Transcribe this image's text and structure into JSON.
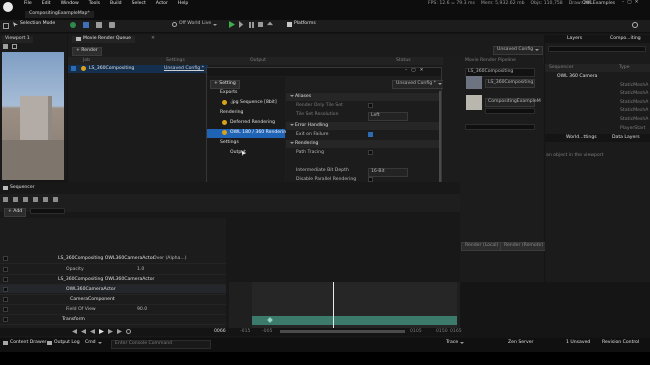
{
  "titlebar": {
    "app_title": "CompositingExampleMap*",
    "project": "OWLExamples",
    "stats": [
      "FPS: 12.6 = 79.3 ms",
      "Mem: 5,932.62 mb",
      "Objs: 110,758",
      "Draw: 291"
    ]
  },
  "menu": [
    "File",
    "Edit",
    "Window",
    "Tools",
    "Build",
    "Select",
    "Actor",
    "Help"
  ],
  "toolbar": {
    "selection_mode": "Selection Mode",
    "world": "Off World Live",
    "platforms": "Platforms"
  },
  "viewport": {
    "tab": "Viewport 1"
  },
  "mrq": {
    "tab": "Movie Render Queue",
    "render_label": "+ Render",
    "cols": [
      "Job",
      "Settings",
      "Output",
      "Status"
    ],
    "job": "LS_360Compositing",
    "job_settings": "Unsaved Config *",
    "unsaved_config": "Unsaved Config"
  },
  "settings_dialog": {
    "add_label": "+ Setting",
    "preset": "Unsaved Config *",
    "categories": [
      {
        "label": "Exports"
      },
      {
        "label": ".jpg Sequence [8bit]"
      },
      {
        "label": "Rendering"
      },
      {
        "label": "Deferred Rendering"
      },
      {
        "label": "OWL 180 / 360 Rendering"
      },
      {
        "label": "Settings"
      },
      {
        "label": "Output"
      }
    ],
    "props": [
      {
        "label": "Aliases"
      },
      {
        "label": "Render Only Tile Set"
      },
      {
        "label": "Tile Set Resolution",
        "value": "Left"
      },
      {
        "label": "Error Handling"
      },
      {
        "label": "Exit on Failure"
      },
      {
        "label": "Rendering"
      },
      {
        "label": "Path Tracing"
      },
      {
        "label": "Intermediate Bit Depth",
        "value": "16-Bit"
      },
      {
        "label": "Disable Parallel Rendering"
      },
      {
        "label": "Interpolation Type",
        "value": "Bilinear Sampling"
      },
      {
        "label": "Advanced"
      },
      {
        "label": "Rendering Nodes",
        "value": "1 Array element"
      },
      {
        "label": "Index [0]",
        "value": "OR"
      },
      {
        "label": "Maintain Frame Order"
      },
      {
        "label": "High Resolution Renders"
      },
      {
        "label": "Intermediate Output Directory",
        "value": "G:/Unreal Projects/OWLExam"
      },
      {
        "label": "Intermediate File Prefix",
        "value": "{sequence_name}_"
      },
      {
        "label": "Job Name Prefix",
        "value": "360"
      }
    ],
    "cancel": "Cancel",
    "accept": "Accept"
  },
  "pipeline": {
    "title": "Movie Render Pipeline",
    "sequence": "LS_360Compositing",
    "composite": "CompositingExampleM",
    "render_local": "Render (Local)",
    "render_remote": "Render (Remote)"
  },
  "outliner": {
    "tabs": [
      "Layers",
      "Compo...iting"
    ],
    "cols": [
      "Sequencer",
      "Type"
    ],
    "items": [
      "OWL 360 Camera",
      "StaticMeshA",
      "StaticMeshA",
      "StaticMeshA",
      "StaticMeshA",
      "StaticMeshA",
      "PlayerStart"
    ],
    "details_tabs": [
      "World...ttings",
      "Data Layers"
    ],
    "hint": "an object in the viewport"
  },
  "sequencer": {
    "tab": "Sequencer",
    "add": "+ Add",
    "search": "Search Tracks",
    "tracks": [
      {
        "label": "LS_360Compositing OWL360CameraActor",
        "value": "Over (Alpha...)"
      },
      {
        "label": "Opacity",
        "value": "1.0"
      },
      {
        "label": "LS_360Compositing OWL360CameraActor"
      },
      {
        "label": "OWL360CameraActor"
      },
      {
        "label": "CameraComponent"
      },
      {
        "label": "Field Of View",
        "value": "90.0"
      },
      {
        "label": "Transform"
      }
    ],
    "frame": "0066",
    "ticks": [
      "-015",
      "-005",
      "0105",
      "0150",
      "0165"
    ]
  },
  "statusbar": {
    "content_drawer": "Content Drawer",
    "output_log": "Output Log",
    "cmd": "Cmd",
    "console": "Enter Console Command",
    "trace": "Trace",
    "zen": "Zen Server",
    "unsaved": "1 Unsaved",
    "revision": "Revision Control"
  }
}
